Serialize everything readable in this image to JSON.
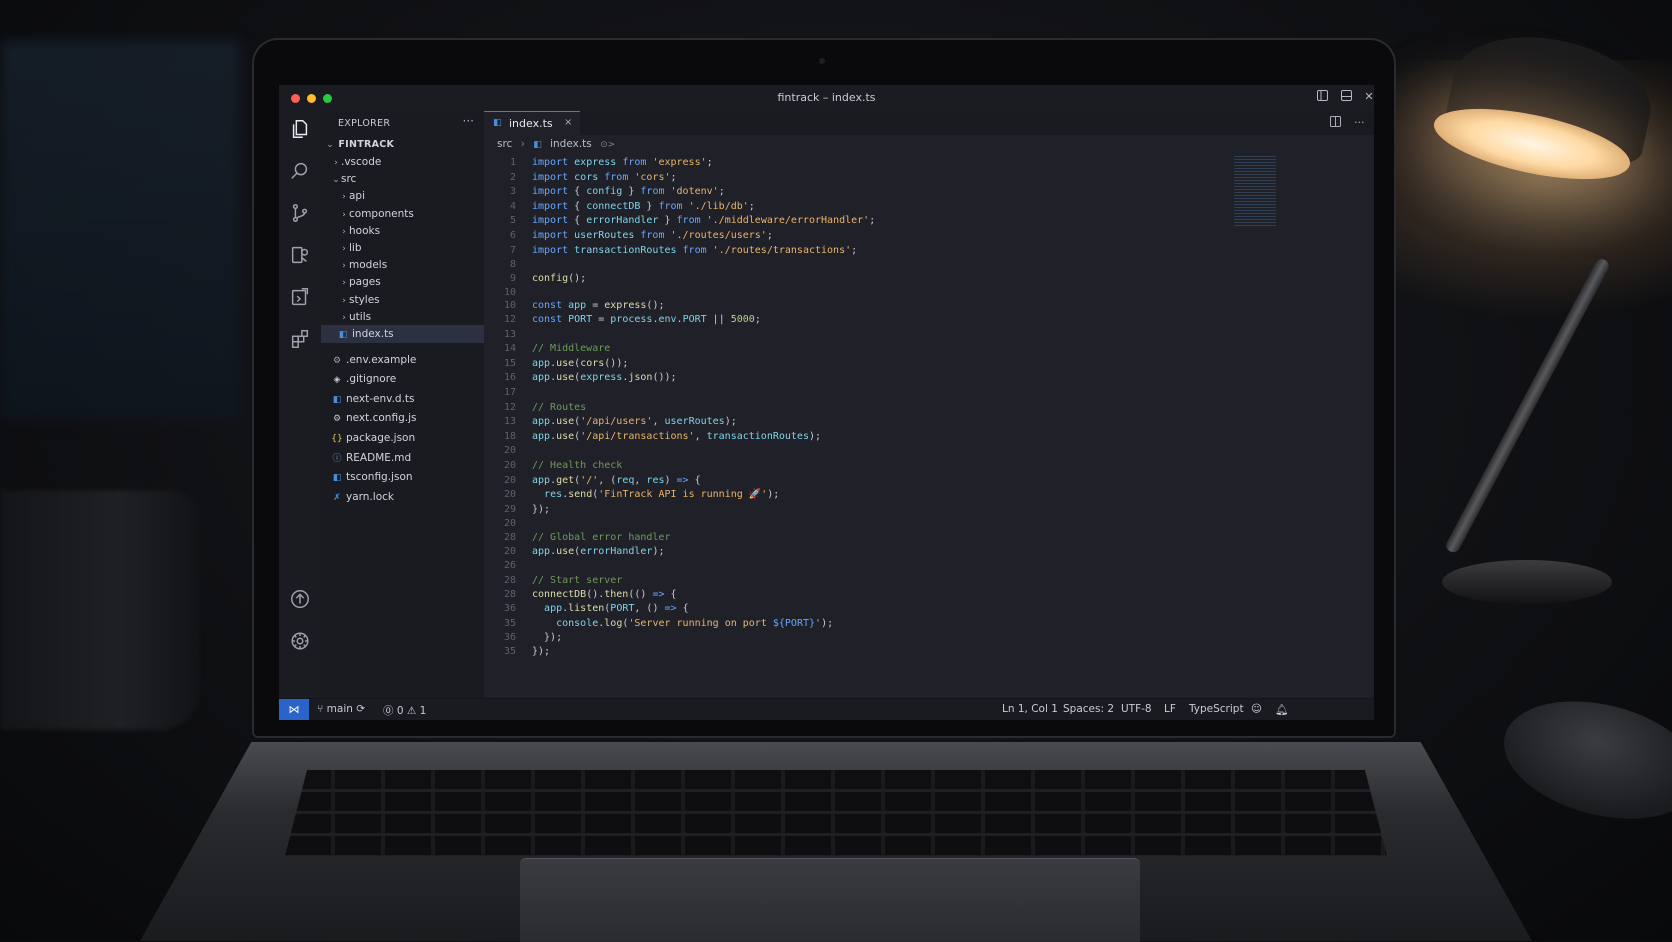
{
  "window": {
    "title": "fintrack – index.ts"
  },
  "explorer": {
    "title": "EXPLORER",
    "more": "···",
    "root": "FINTRACK",
    "tree": [
      {
        "label": ".vscode",
        "kind": "folder",
        "depth": 1,
        "open": false
      },
      {
        "label": "src",
        "kind": "folder",
        "depth": 1,
        "open": true
      },
      {
        "label": "api",
        "kind": "folder",
        "depth": 2,
        "open": false
      },
      {
        "label": "components",
        "kind": "folder",
        "depth": 2,
        "open": false
      },
      {
        "label": "hooks",
        "kind": "folder",
        "depth": 2,
        "open": false
      },
      {
        "label": "lib",
        "kind": "folder",
        "depth": 2,
        "open": false
      },
      {
        "label": "models",
        "kind": "folder",
        "depth": 2,
        "open": false
      },
      {
        "label": "pages",
        "kind": "folder",
        "depth": 2,
        "open": false
      },
      {
        "label": "styles",
        "kind": "folder",
        "depth": 2,
        "open": false
      },
      {
        "label": "utils",
        "kind": "folder",
        "depth": 2,
        "open": false
      },
      {
        "label": "index.ts",
        "kind": "file",
        "depth": 2,
        "icon": "ts-file-icon",
        "selected": true
      },
      {
        "label": ".env.example",
        "kind": "file",
        "depth": 1,
        "icon": "env-file-icon"
      },
      {
        "label": ".gitignore",
        "kind": "file",
        "depth": 1,
        "icon": "git-file-icon"
      },
      {
        "label": "next-env.d.ts",
        "kind": "file",
        "depth": 1,
        "icon": "ts-file-icon"
      },
      {
        "label": "next.config.js",
        "kind": "file",
        "depth": 1,
        "icon": "config-file-icon"
      },
      {
        "label": "package.json",
        "kind": "file",
        "depth": 1,
        "icon": "json-file-icon"
      },
      {
        "label": "README.md",
        "kind": "file",
        "depth": 1,
        "icon": "info-file-icon"
      },
      {
        "label": "tsconfig.json",
        "kind": "file",
        "depth": 1,
        "icon": "ts-file-icon"
      },
      {
        "label": "yarn.lock",
        "kind": "file",
        "depth": 1,
        "icon": "yarn-file-icon"
      }
    ]
  },
  "tab": {
    "label": "index.ts",
    "close": "×"
  },
  "breadcrumb": {
    "folder": "src",
    "file": "index.ts",
    "symbol": "⊙>"
  },
  "code": [
    {
      "n": "1",
      "t": [
        [
          "k",
          "import "
        ],
        [
          "v",
          "express "
        ],
        [
          "k",
          "from "
        ],
        [
          "s",
          "'express'"
        ],
        [
          "",
          "; "
        ]
      ]
    },
    {
      "n": "2",
      "t": [
        [
          "k",
          "import "
        ],
        [
          "v",
          "cors "
        ],
        [
          "k",
          "from "
        ],
        [
          "s",
          "'cors'"
        ],
        [
          "",
          ";"
        ]
      ]
    },
    {
      "n": "3",
      "t": [
        [
          "k",
          "import "
        ],
        [
          "",
          "{ "
        ],
        [
          "v",
          "config "
        ],
        [
          "",
          "} "
        ],
        [
          "k",
          "from "
        ],
        [
          "s",
          "'dotenv'"
        ],
        [
          "",
          ";"
        ]
      ]
    },
    {
      "n": "4",
      "t": [
        [
          "k",
          "import "
        ],
        [
          "",
          "{ "
        ],
        [
          "v",
          "connectDB "
        ],
        [
          "",
          "} "
        ],
        [
          "k",
          "from "
        ],
        [
          "s",
          "'./lib/db'"
        ],
        [
          "",
          ";"
        ]
      ]
    },
    {
      "n": "5",
      "t": [
        [
          "k",
          "import "
        ],
        [
          "",
          "{ "
        ],
        [
          "v",
          "errorHandler "
        ],
        [
          "",
          "} "
        ],
        [
          "k",
          "from "
        ],
        [
          "s",
          "'./middleware/errorHandler'"
        ],
        [
          "",
          ";"
        ]
      ]
    },
    {
      "n": "6",
      "t": [
        [
          "k",
          "import "
        ],
        [
          "v",
          "userRoutes "
        ],
        [
          "k",
          "from "
        ],
        [
          "s",
          "'./routes/users'"
        ],
        [
          "",
          ";"
        ]
      ]
    },
    {
      "n": "7",
      "t": [
        [
          "k",
          "import "
        ],
        [
          "v",
          "transactionRoutes "
        ],
        [
          "k",
          "from "
        ],
        [
          "s",
          "'./routes/transactions'"
        ],
        [
          "",
          ";"
        ]
      ]
    },
    {
      "n": "8",
      "t": []
    },
    {
      "n": "9",
      "t": [
        [
          "f",
          "config"
        ],
        [
          "",
          "();"
        ]
      ]
    },
    {
      "n": "10",
      "t": []
    },
    {
      "n": "10",
      "t": [
        [
          "k",
          "const "
        ],
        [
          "v",
          "app "
        ],
        [
          "",
          "= "
        ],
        [
          "f",
          "express"
        ],
        [
          "",
          "();"
        ]
      ]
    },
    {
      "n": "12",
      "t": [
        [
          "k",
          "const "
        ],
        [
          "v",
          "PORT "
        ],
        [
          "",
          "= "
        ],
        [
          "v",
          "process"
        ],
        [
          "",
          "."
        ],
        [
          "v",
          "env"
        ],
        [
          "",
          "."
        ],
        [
          "v",
          "PORT "
        ],
        [
          "",
          "|| "
        ],
        [
          "n",
          "5000"
        ],
        [
          "",
          ";"
        ]
      ]
    },
    {
      "n": "13",
      "t": []
    },
    {
      "n": "14",
      "t": [
        [
          "c",
          "// Middleware"
        ]
      ]
    },
    {
      "n": "15",
      "t": [
        [
          "v",
          "app"
        ],
        [
          "",
          "."
        ],
        [
          "f",
          "use"
        ],
        [
          "",
          "("
        ],
        [
          "f",
          "cors"
        ],
        [
          "",
          "());"
        ]
      ]
    },
    {
      "n": "16",
      "t": [
        [
          "v",
          "app"
        ],
        [
          "",
          "."
        ],
        [
          "f",
          "use"
        ],
        [
          "",
          "("
        ],
        [
          "v",
          "express"
        ],
        [
          "",
          "."
        ],
        [
          "f",
          "json"
        ],
        [
          "",
          "());"
        ]
      ]
    },
    {
      "n": "17",
      "t": []
    },
    {
      "n": "12",
      "t": [
        [
          "c",
          "// Routes"
        ]
      ]
    },
    {
      "n": "13",
      "t": [
        [
          "v",
          "app"
        ],
        [
          "",
          "."
        ],
        [
          "f",
          "use"
        ],
        [
          "",
          "("
        ],
        [
          "s",
          "'/api/users'"
        ],
        [
          "",
          ", "
        ],
        [
          "v",
          "userRoutes"
        ],
        [
          "",
          ");"
        ]
      ]
    },
    {
      "n": "18",
      "t": [
        [
          "v",
          "app"
        ],
        [
          "",
          "."
        ],
        [
          "f",
          "use"
        ],
        [
          "",
          "("
        ],
        [
          "s",
          "'/api/transactions'"
        ],
        [
          "",
          ", "
        ],
        [
          "v",
          "transactionRoutes"
        ],
        [
          "",
          ");"
        ]
      ]
    },
    {
      "n": "20",
      "t": []
    },
    {
      "n": "20",
      "t": [
        [
          "c",
          "// Health check"
        ]
      ]
    },
    {
      "n": "20",
      "t": [
        [
          "v",
          "app"
        ],
        [
          "",
          "."
        ],
        [
          "f",
          "get"
        ],
        [
          "",
          "("
        ],
        [
          "s",
          "'/'"
        ],
        [
          "",
          ", ("
        ],
        [
          "v",
          "req"
        ],
        [
          "",
          ", "
        ],
        [
          "v",
          "res"
        ],
        [
          "",
          ") "
        ],
        [
          "k",
          "=> "
        ],
        [
          "",
          "{"
        ]
      ]
    },
    {
      "n": "20",
      "t": [
        [
          "",
          "  "
        ],
        [
          "v",
          "res"
        ],
        [
          "",
          "."
        ],
        [
          "f",
          "send"
        ],
        [
          "",
          "("
        ],
        [
          "s",
          "'FinTrack API is running 🚀'"
        ],
        [
          "",
          ");"
        ]
      ]
    },
    {
      "n": "29",
      "t": [
        [
          "",
          "});"
        ]
      ]
    },
    {
      "n": "20",
      "t": []
    },
    {
      "n": "28",
      "t": [
        [
          "c",
          "// Global error handler"
        ]
      ]
    },
    {
      "n": "20",
      "t": [
        [
          "v",
          "app"
        ],
        [
          "",
          "."
        ],
        [
          "f",
          "use"
        ],
        [
          "",
          "("
        ],
        [
          "v",
          "errorHandler"
        ],
        [
          "",
          ");"
        ]
      ]
    },
    {
      "n": "26",
      "t": []
    },
    {
      "n": "28",
      "t": [
        [
          "c",
          "// Start server"
        ]
      ]
    },
    {
      "n": "28",
      "t": [
        [
          "f",
          "connectDB"
        ],
        [
          "",
          "()."
        ],
        [
          "f",
          "then"
        ],
        [
          "",
          "(() "
        ],
        [
          "k",
          "=> "
        ],
        [
          "",
          "{"
        ]
      ]
    },
    {
      "n": "36",
      "t": [
        [
          "",
          "  "
        ],
        [
          "v",
          "app"
        ],
        [
          "",
          "."
        ],
        [
          "f",
          "listen"
        ],
        [
          "",
          "("
        ],
        [
          "v",
          "PORT"
        ],
        [
          "",
          ", () "
        ],
        [
          "k",
          "=> "
        ],
        [
          "",
          "{"
        ]
      ]
    },
    {
      "n": "35",
      "t": [
        [
          "",
          "    "
        ],
        [
          "v",
          "console"
        ],
        [
          "",
          "."
        ],
        [
          "f",
          "log"
        ],
        [
          "",
          "("
        ],
        [
          "s",
          "'Server running on port "
        ],
        [
          "k",
          "${PORT}"
        ],
        [
          "s",
          "'"
        ],
        [
          "",
          ");"
        ]
      ]
    },
    {
      "n": "36",
      "t": [
        [
          "",
          "  });"
        ]
      ]
    },
    {
      "n": "35",
      "t": [
        [
          "",
          "});"
        ]
      ]
    }
  ],
  "status": {
    "branch": "main",
    "problems": "⓪ 0 ⚠ 1",
    "position": "Ln 1, Col 1",
    "spaces": "Spaces: 2",
    "encoding": "UTF-8",
    "eol": "LF",
    "language": "TypeScript"
  },
  "colors": {
    "accent": "#2a63c9",
    "tab_border": "#3d7fd6"
  }
}
